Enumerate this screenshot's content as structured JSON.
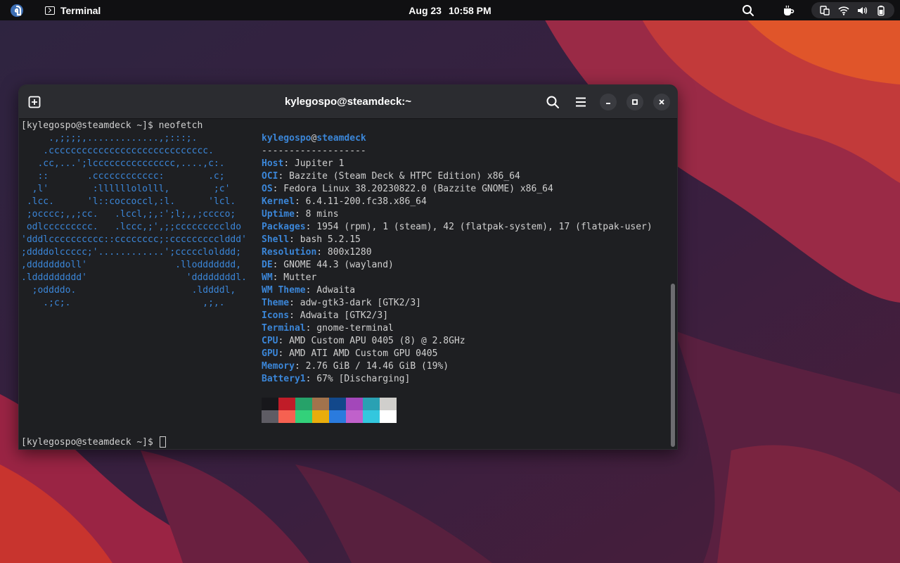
{
  "topbar": {
    "app_name": "Terminal",
    "date": "Aug 23",
    "time": "10:58 PM"
  },
  "window": {
    "title": "kylegospo@steamdeck:~"
  },
  "terminal": {
    "command_line": "[kylegospo@steamdeck ~]$ neofetch",
    "prompt_line": "[kylegospo@steamdeck ~]$ ",
    "logo": [
      "     .,;;;;,.............,;:::;.",
      "    .ccccccccccccccccccccccccccccc.",
      "   .cc,...';lccccccccccccccc,....,c:.",
      "   ::       .cccccccccccc:        .c;",
      "  ,l'        :llllllololll,        ;c'",
      " .lcc.      'l::coccoccl,:l.      'lcl.",
      " ;occcc;,,;cc.   .lccl,;,:';l;,,;cccco;",
      " odlccccccccc.   .lccc,;',;;cccccccccldo",
      "'dddlcccccccccc::cccccccc;:ccccccccclddd'",
      ";ddddolccccc;'............';ccccclolddd;",
      ",dddddddoll'                .lloddddddd,",
      ".lddddddddd'                  'ddddddddl.",
      "  ;oddddo.                     .lddddl,",
      "    .;c;.                        ,;,."
    ],
    "user": "kylegospo",
    "at": "@",
    "host": "steamdeck",
    "separator": "-------------------",
    "info": [
      {
        "key": "Host",
        "value": ": Jupiter 1"
      },
      {
        "key": "OCI",
        "value": ": Bazzite (Steam Deck & HTPC Edition) x86_64"
      },
      {
        "key": "OS",
        "value": ": Fedora Linux 38.20230822.0 (Bazzite GNOME) x86_64"
      },
      {
        "key": "Kernel",
        "value": ": 6.4.11-200.fc38.x86_64"
      },
      {
        "key": "Uptime",
        "value": ": 8 mins"
      },
      {
        "key": "Packages",
        "value": ": 1954 (rpm), 1 (steam), 42 (flatpak-system), 17 (flatpak-user)"
      },
      {
        "key": "Shell",
        "value": ": bash 5.2.15"
      },
      {
        "key": "Resolution",
        "value": ": 800x1280"
      },
      {
        "key": "DE",
        "value": ": GNOME 44.3 (wayland)"
      },
      {
        "key": "WM",
        "value": ": Mutter"
      },
      {
        "key": "WM Theme",
        "value": ": Adwaita"
      },
      {
        "key": "Theme",
        "value": ": adw-gtk3-dark [GTK2/3]"
      },
      {
        "key": "Icons",
        "value": ": Adwaita [GTK2/3]"
      },
      {
        "key": "Terminal",
        "value": ": gnome-terminal"
      },
      {
        "key": "CPU",
        "value": ": AMD Custom APU 0405 (8) @ 2.8GHz"
      },
      {
        "key": "GPU",
        "value": ": AMD ATI AMD Custom GPU 0405"
      },
      {
        "key": "Memory",
        "value": ": 2.76 GiB / 14.46 GiB (19%)"
      },
      {
        "key": "Battery1",
        "value": ": 67% [Discharging]"
      }
    ],
    "palette_dark": [
      "#17171b",
      "#c01c28",
      "#26a269",
      "#a2734c",
      "#12488b",
      "#a347ba",
      "#2aa1b3",
      "#d0cfcc"
    ],
    "palette_bright": [
      "#5e5c64",
      "#f66151",
      "#33d17a",
      "#e9ad0c",
      "#2a7bde",
      "#c061cb",
      "#33c7de",
      "#ffffff"
    ]
  },
  "colors": {
    "accent_blue": "#3b86d8",
    "topbar_bg": "#101012",
    "headerbar_bg": "#2b2c30",
    "terminal_bg": "#1e1f22"
  },
  "icons": {
    "activities": "fedora-logo-icon",
    "app_menu": "terminal-icon",
    "search": "search-icon",
    "coffee": "caffeine-icon",
    "status": [
      "display-icon",
      "wifi-icon",
      "volume-icon",
      "battery-icon"
    ]
  }
}
